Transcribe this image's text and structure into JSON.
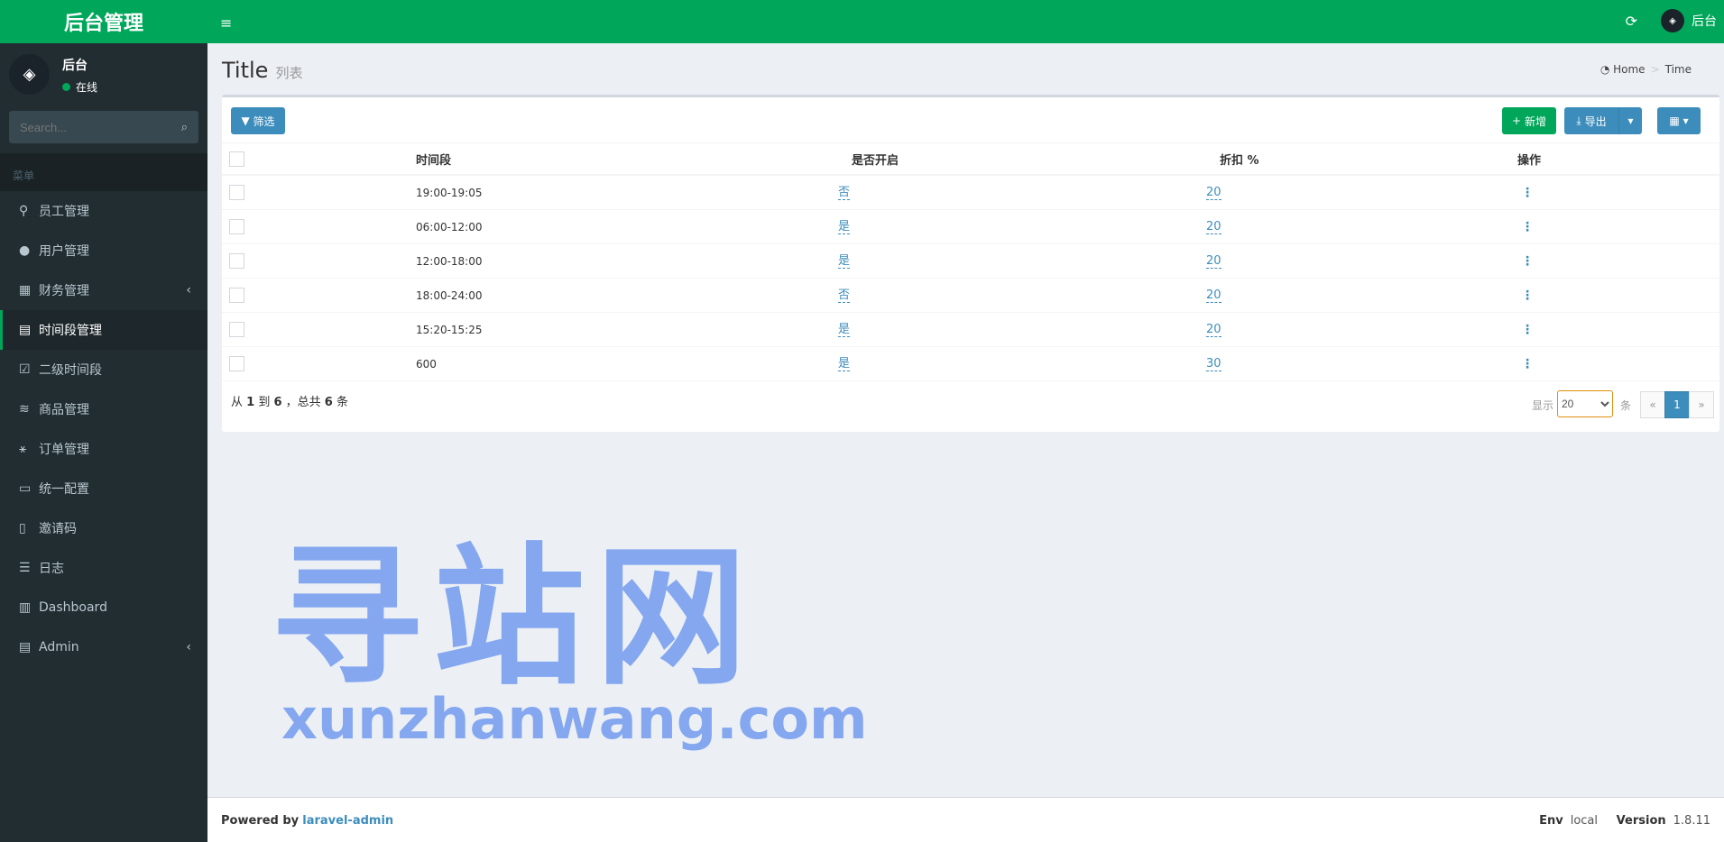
{
  "app": {
    "logo_text": "后台管理",
    "brand_color": "#00a65a"
  },
  "topbar": {
    "menu_icon": "hamburger-icon",
    "refresh_icon": "refresh-icon",
    "user_name": "后台"
  },
  "sidebar": {
    "user": {
      "name": "后台",
      "status": "在线"
    },
    "search_placeholder": "Search...",
    "menu_header": "菜单",
    "items": [
      {
        "label": "员工管理",
        "icon": "⚲",
        "active": false,
        "has_arrow": false
      },
      {
        "label": "用户管理",
        "icon": "●",
        "active": false,
        "has_arrow": false
      },
      {
        "label": "财务管理",
        "icon": "▦",
        "active": false,
        "has_arrow": true
      },
      {
        "label": "时间段管理",
        "icon": "▤",
        "active": true,
        "has_arrow": false
      },
      {
        "label": "二级时间段",
        "icon": "☑",
        "active": false,
        "has_arrow": false
      },
      {
        "label": "商品管理",
        "icon": "≋",
        "active": false,
        "has_arrow": false
      },
      {
        "label": "订单管理",
        "icon": "⚹",
        "active": false,
        "has_arrow": false
      },
      {
        "label": "统一配置",
        "icon": "▭",
        "active": false,
        "has_arrow": false
      },
      {
        "label": "邀请码",
        "icon": "▯",
        "active": false,
        "has_arrow": false
      },
      {
        "label": "日志",
        "icon": "☰",
        "active": false,
        "has_arrow": false
      },
      {
        "label": "Dashboard",
        "icon": "▥",
        "active": false,
        "has_arrow": false
      },
      {
        "label": "Admin",
        "icon": "▤",
        "active": false,
        "has_arrow": true
      }
    ],
    "arrow": "‹"
  },
  "page": {
    "title": "Title",
    "subtitle": "列表",
    "breadcrumb": {
      "home": "Home",
      "current": "Time",
      "separator": ">"
    }
  },
  "toolbar": {
    "filter_label": "筛选",
    "new_label": "新增",
    "export_label": "导出",
    "caret": "▾",
    "columns_icon": "▦"
  },
  "table": {
    "headers": [
      "时间段",
      "是否开启",
      "折扣 %",
      "操作"
    ],
    "rows": [
      {
        "period": "19:00-19:05",
        "enabled": "否",
        "discount": "20",
        "action": "⋮"
      },
      {
        "period": "06:00-12:00",
        "enabled": "是",
        "discount": "20",
        "action": "⋮"
      },
      {
        "period": "12:00-18:00",
        "enabled": "是",
        "discount": "20",
        "action": "⋮"
      },
      {
        "period": "18:00-24:00",
        "enabled": "否",
        "discount": "20",
        "action": "⋮"
      },
      {
        "period": "15:20-15:25",
        "enabled": "是",
        "discount": "20",
        "action": "⋮"
      },
      {
        "period": "600",
        "enabled": "是",
        "discount": "30",
        "action": "⋮"
      }
    ]
  },
  "pagination": {
    "summary_parts": [
      "从 ",
      "1",
      " 到 ",
      "6",
      " ，总共 ",
      "6",
      " 条"
    ],
    "show_label": "显示",
    "per_page": "20",
    "unit_label": "条",
    "prev": "«",
    "current": "1",
    "next": "»"
  },
  "watermark": {
    "big": "寻站网",
    "small": "xunzhanwang.com"
  },
  "footer": {
    "powered_by": "Powered by",
    "link": "laravel-admin",
    "env_label": "Env",
    "env_value": "local",
    "version_label": "Version",
    "version_value": "1.8.11"
  }
}
